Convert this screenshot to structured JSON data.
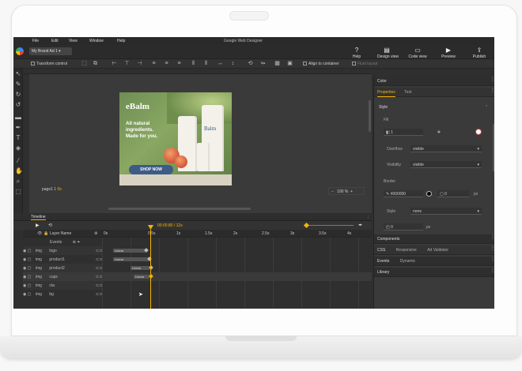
{
  "app": {
    "title": "Google Web Designer"
  },
  "menu": [
    "File",
    "Edit",
    "View",
    "Window",
    "Help"
  ],
  "file_tab": "My Brand Ad 1",
  "header_buttons": [
    {
      "label": "Help",
      "icon": "help-icon"
    },
    {
      "label": "Design view",
      "icon": "design-view-icon"
    },
    {
      "label": "Code view",
      "icon": "code-view-icon"
    },
    {
      "label": "Preview",
      "icon": "preview-icon"
    },
    {
      "label": "Publish",
      "icon": "publish-icon"
    }
  ],
  "toolbar": {
    "transform_control": "Transform control",
    "align_to_container": "Align to container",
    "fluid_layout": "Fluid layout"
  },
  "canvas": {
    "page_label": "page1",
    "page_index": "1",
    "page_suffix": "0s",
    "zoom": "100 %"
  },
  "ad": {
    "brand": "eBalm",
    "lines": [
      "All natural",
      "ingredients.",
      "Made for you."
    ],
    "cta": "SHOP NOW",
    "tube_brand": "Balm"
  },
  "timeline": {
    "title": "Timeline",
    "time": "00:00.80 / 12s",
    "ticks": [
      "0s",
      "0.5s",
      "1s",
      "1.5s",
      "2s",
      "2.5s",
      "3s",
      "3.5s",
      "4s"
    ],
    "layer_header": "Layer Name",
    "events_label": "Events",
    "rows": [
      {
        "type": "img",
        "name": "logo",
        "bar": "Linear"
      },
      {
        "type": "img",
        "name": "product1",
        "bar": "Linear"
      },
      {
        "type": "img",
        "name": "product2",
        "bar": "Linear"
      },
      {
        "type": "img",
        "name": "cups",
        "bar": "Linear"
      },
      {
        "type": "img",
        "name": "cta",
        "bar": ""
      },
      {
        "type": "img",
        "name": "bg",
        "bar": ""
      }
    ]
  },
  "right_panel": {
    "color_tab": "Color",
    "properties_tab": "Properties",
    "text_tab": "Text",
    "style_section": "Style",
    "fill_label": "Fill",
    "fill_value": "1",
    "overflow_label": "Overflow",
    "overflow_value": "visible",
    "visibility_label": "Visibility",
    "visibility_value": "visible",
    "border_label": "Border",
    "border_color": "#000000",
    "border_width": "0",
    "border_unit": "px",
    "border_style_label": "Style",
    "border_style_value": "none",
    "radius_value": "0",
    "radius_unit": "px",
    "components_tab": "Components",
    "css_tab": "CSS",
    "responsive_tab": "Responsive",
    "ad_validator_tab": "Ad Validator",
    "events_tab": "Events",
    "dynamic_tab": "Dynamic",
    "library_tab": "Library"
  },
  "colors": {
    "accent": "#f5b400",
    "panel": "#3a3a3a",
    "cta": "#3d5b86"
  }
}
